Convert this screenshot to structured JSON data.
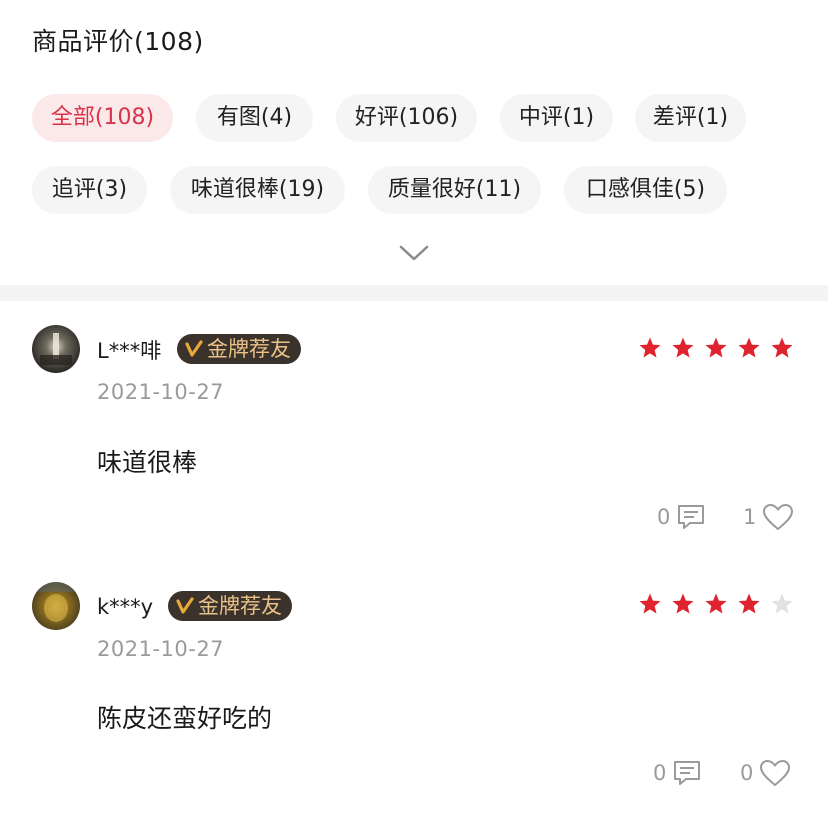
{
  "header": {
    "title": "商品评价(108)"
  },
  "filters": [
    {
      "label": "全部(108)",
      "active": true
    },
    {
      "label": "有图(4)"
    },
    {
      "label": "好评(106)"
    },
    {
      "label": "中评(1)"
    },
    {
      "label": "差评(1)"
    },
    {
      "label": "追评(3)"
    },
    {
      "label": "味道很棒(19)"
    },
    {
      "label": "质量很好(11)"
    },
    {
      "label": "口感俱佳(5)"
    }
  ],
  "expand_icon": "chevron-down-icon",
  "colors": {
    "accent": "#d9334a",
    "chip_active_bg": "#fbe9ea",
    "badge_bg": "#3b332b",
    "badge_text": "#e9c28a",
    "star_filled": "#e0242f",
    "star_empty": "#e2e2e2",
    "muted": "#9a9a9a"
  },
  "reviews": [
    {
      "username": "L***啡",
      "badge": "金牌荐友",
      "rating": 5,
      "date": "2021-10-27",
      "content": "味道很棒",
      "comment_count": "0",
      "like_count": "1"
    },
    {
      "username": "k***y",
      "badge": "金牌荐友",
      "rating": 4,
      "date": "2021-10-27",
      "content": "陈皮还蛮好吃的",
      "comment_count": "0",
      "like_count": "0"
    }
  ]
}
